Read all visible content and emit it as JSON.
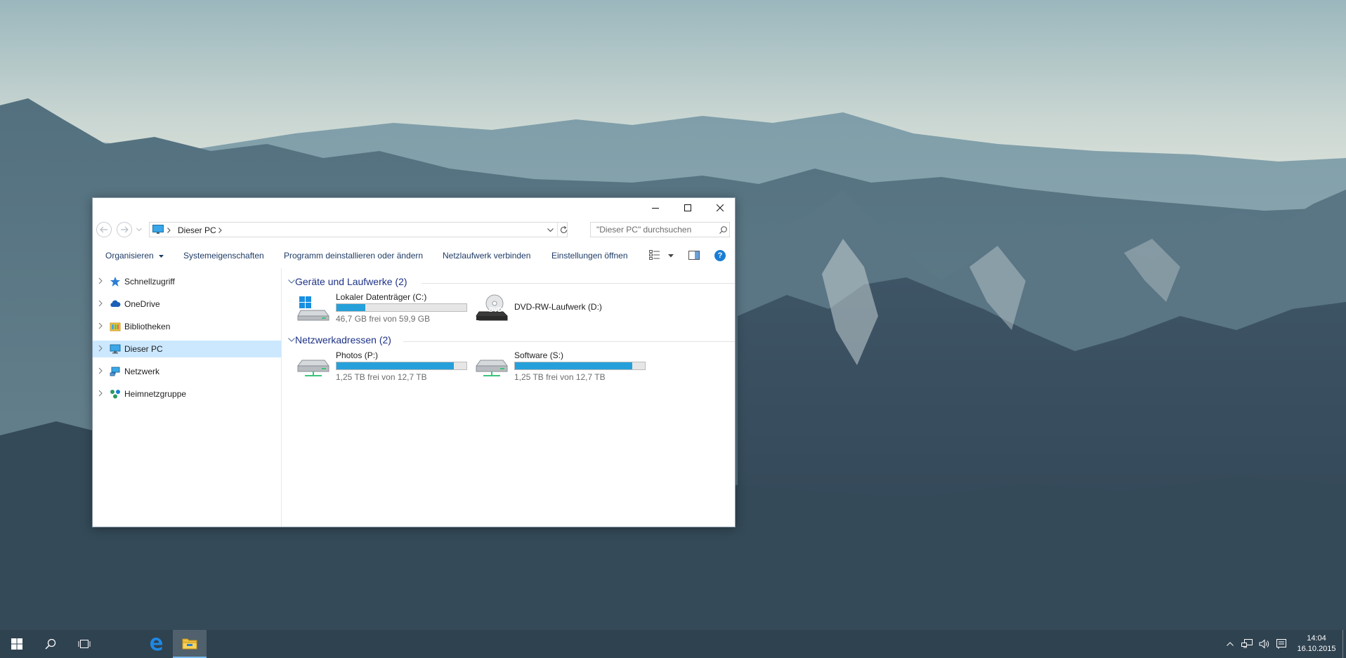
{
  "window": {
    "minimize_tooltip": "",
    "address": {
      "crumb": "Dieser PC"
    },
    "search": {
      "placeholder": "\"Dieser PC\" durchsuchen"
    },
    "commands": {
      "organize": "Organisieren",
      "system_properties": "Systemeigenschaften",
      "uninstall": "Programm deinstallieren oder ändern",
      "map_drive": "Netzlaufwerk verbinden",
      "open_settings": "Einstellungen öffnen"
    },
    "nav": [
      {
        "label": "Schnellzugriff",
        "icon": "star-icon"
      },
      {
        "label": "OneDrive",
        "icon": "cloud-icon"
      },
      {
        "label": "Bibliotheken",
        "icon": "library-icon"
      },
      {
        "label": "Dieser PC",
        "icon": "monitor-icon",
        "selected": true
      },
      {
        "label": "Netzwerk",
        "icon": "network-icon"
      },
      {
        "label": "Heimnetzgruppe",
        "icon": "homegroup-icon"
      }
    ],
    "groups": {
      "devices": {
        "title": "Geräte und Laufwerke (2)"
      },
      "network": {
        "title": "Netzwerkadressen (2)"
      }
    },
    "drives": {
      "c": {
        "name": "Lokaler Datenträger (C:)",
        "free": "46,7 GB frei von 59,9 GB",
        "used_fraction": 0.22
      },
      "d": {
        "name": "DVD-RW-Laufwerk (D:)",
        "badge": "DVD"
      },
      "p": {
        "name": "Photos (P:)",
        "free": "1,25 TB frei von 12,7 TB",
        "used_fraction": 0.9
      },
      "s": {
        "name": "Software (S:)",
        "free": "1,25 TB frei von 12,7 TB",
        "used_fraction": 0.9
      }
    }
  },
  "taskbar": {
    "clock": {
      "time": "14:04",
      "date": "16.10.2015"
    },
    "accent": "#0078d7",
    "apps": [
      "windows-start-icon",
      "search-icon",
      "task-view-icon",
      "edge-icon",
      "file-explorer-icon"
    ]
  }
}
